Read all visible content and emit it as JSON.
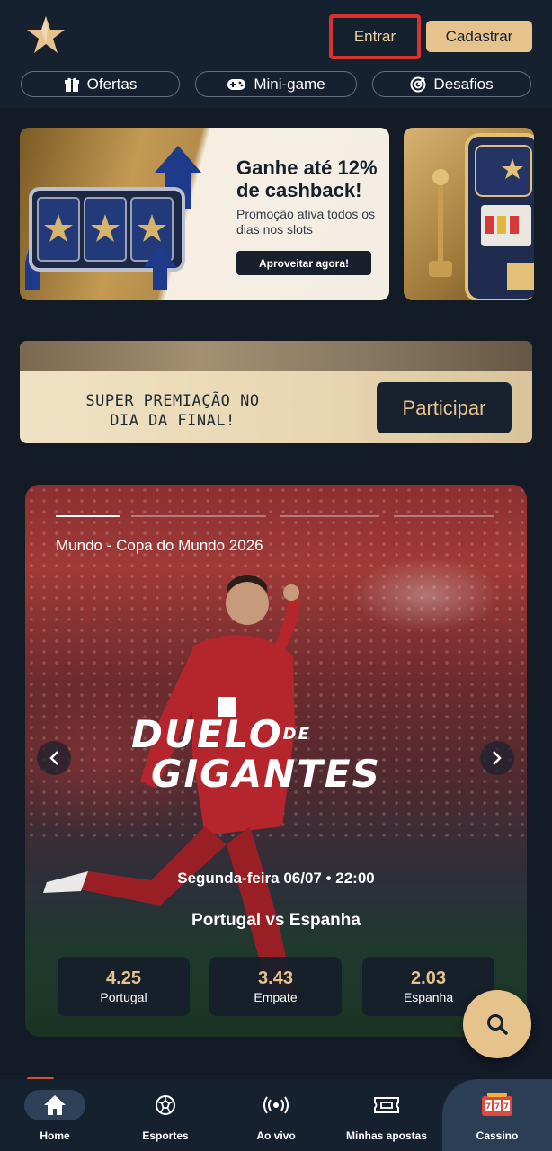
{
  "header": {
    "login_label": "Entrar",
    "signup_label": "Cadastrar",
    "pills": [
      {
        "label": "Ofertas",
        "icon": "gift-icon"
      },
      {
        "label": "Mini-game",
        "icon": "gamepad-icon"
      },
      {
        "label": "Desafios",
        "icon": "target-icon"
      }
    ]
  },
  "promo_cashback": {
    "title": "Ganhe até 12% de cashback!",
    "subtitle": "Promoção ativa todos os dias nos slots",
    "cta": "Aproveitar agora!"
  },
  "premiacao": {
    "text": "SUPER PREMIAÇÃO NO DIA DA FINAL!",
    "cta": "Participar"
  },
  "match": {
    "league": "Mundo - Copa do Mundo 2026",
    "title_line1": "DUELO",
    "title_de": "DE",
    "title_line2": "GIGANTES",
    "date": "Segunda-feira 06/07 • 22:00",
    "teams": "Portugal vs Espanha",
    "slides_total": 4,
    "slide_active": 1,
    "odds": [
      {
        "value": "4.25",
        "label": "Portugal"
      },
      {
        "value": "3.43",
        "label": "Empate"
      },
      {
        "value": "2.03",
        "label": "Espanha"
      }
    ]
  },
  "bottom_nav": [
    {
      "label": "Home",
      "icon": "home-icon",
      "active": true
    },
    {
      "label": "Esportes",
      "icon": "soccer-ball-icon"
    },
    {
      "label": "Ao vivo",
      "icon": "live-broadcast-icon"
    },
    {
      "label": "Minhas apostas",
      "icon": "ticket-icon"
    },
    {
      "label": "Cassino",
      "icon": "slot-machine-icon"
    }
  ],
  "colors": {
    "accent_gold": "#e6c28d",
    "background": "#131b27",
    "header_bg": "#162130",
    "highlight_red": "#d63331"
  }
}
